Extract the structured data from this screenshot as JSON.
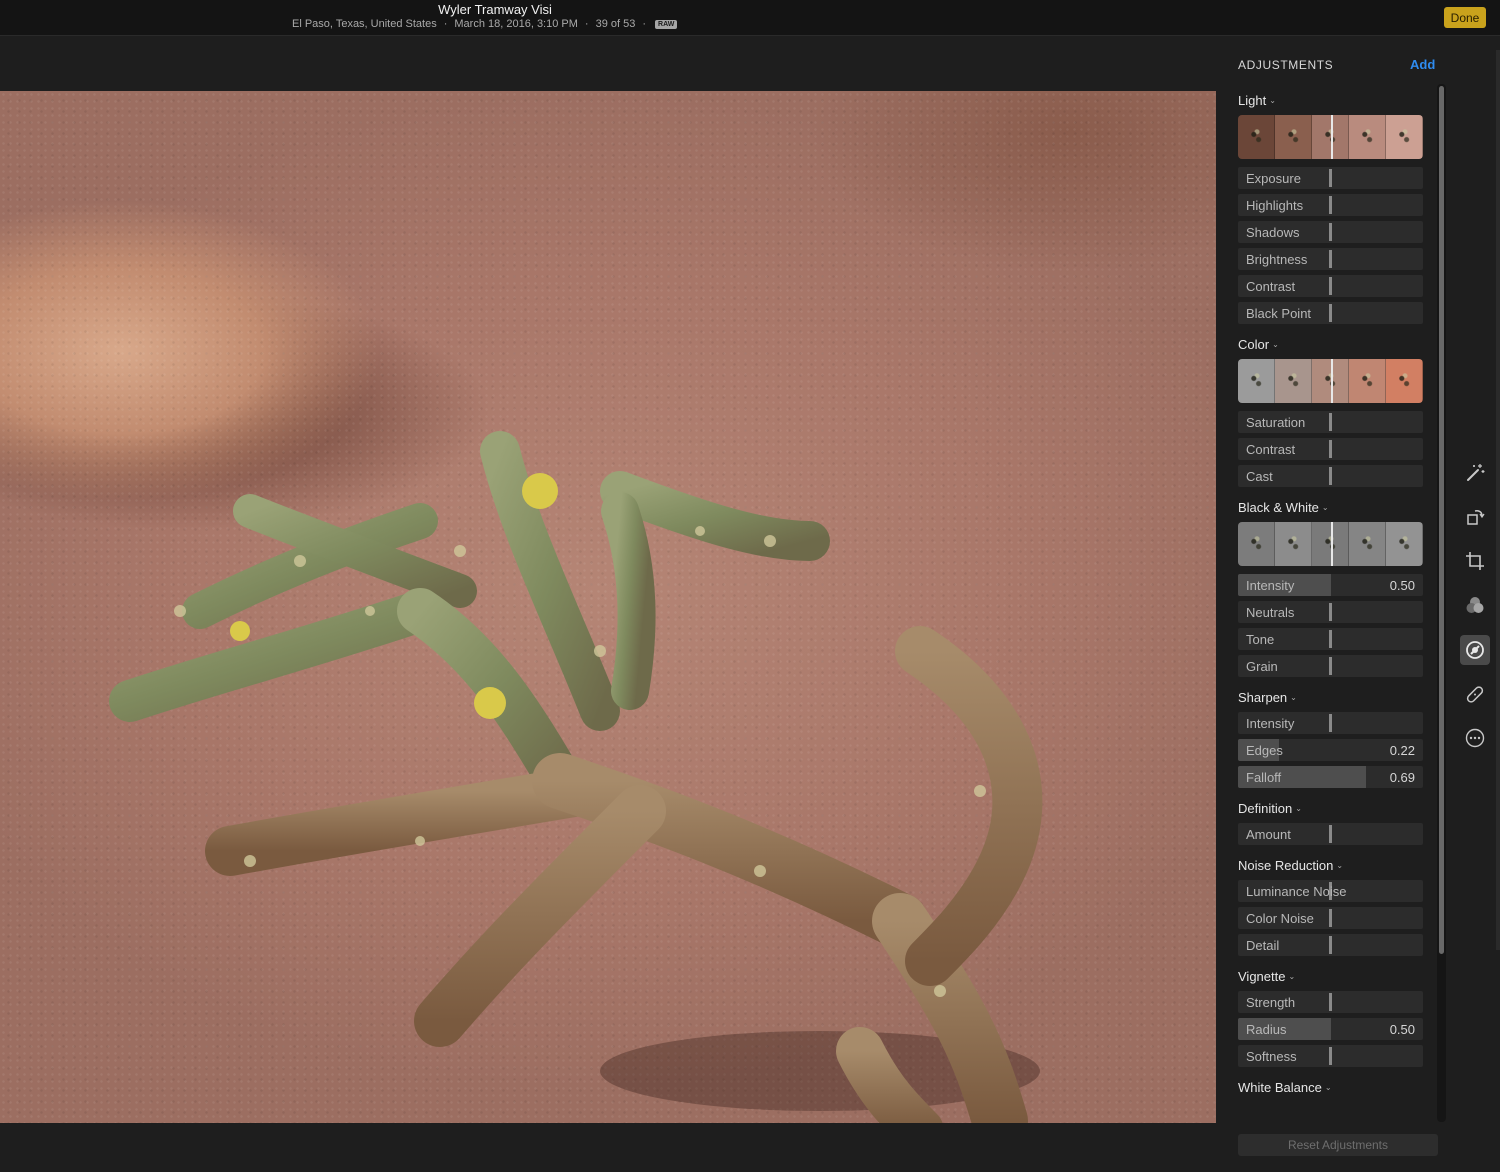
{
  "header": {
    "title": "Wyler Tramway Visi",
    "location": "El Paso, Texas, United States",
    "separator": "·",
    "datetime": "March 18, 2016, 3:10 PM",
    "counter": "39 of 53",
    "raw_badge": "RAW",
    "done_label": "Done"
  },
  "panel": {
    "heading": "ADJUSTMENTS",
    "add_label": "Add",
    "reset_label": "Reset Adjustments",
    "chevron": "⌄",
    "sections": [
      {
        "title": "Light",
        "thumbs": true,
        "thumb_colors": [
          "#6b4638",
          "#8a5f4e",
          "#a2776a",
          "#b98b7e",
          "#cca093"
        ],
        "sliders": [
          {
            "label": "Exposure",
            "value": "",
            "level": 0
          },
          {
            "label": "Highlights",
            "value": "",
            "level": 0
          },
          {
            "label": "Shadows",
            "value": "",
            "level": 0
          },
          {
            "label": "Brightness",
            "value": "",
            "level": 0
          },
          {
            "label": "Contrast",
            "value": "",
            "level": 0
          },
          {
            "label": "Black Point",
            "value": "",
            "level": 0
          }
        ]
      },
      {
        "title": "Color",
        "thumbs": true,
        "thumb_colors": [
          "#9b9b9b",
          "#a8958d",
          "#b08b7d",
          "#c08672",
          "#d27f63"
        ],
        "sliders": [
          {
            "label": "Saturation",
            "value": "",
            "level": 0
          },
          {
            "label": "Contrast",
            "value": "",
            "level": 0
          },
          {
            "label": "Cast",
            "value": "",
            "level": 0
          }
        ]
      },
      {
        "title": "Black & White",
        "thumbs": true,
        "thumb_colors": [
          "#7c7c7c",
          "#8c8c8c",
          "#7a7a7a",
          "#858585",
          "#939393"
        ],
        "sliders": [
          {
            "label": "Intensity",
            "value": "0.50",
            "level": 0.5
          },
          {
            "label": "Neutrals",
            "value": "",
            "level": 0
          },
          {
            "label": "Tone",
            "value": "",
            "level": 0
          },
          {
            "label": "Grain",
            "value": "",
            "level": 0
          }
        ]
      },
      {
        "title": "Sharpen",
        "thumbs": false,
        "sliders": [
          {
            "label": "Intensity",
            "value": "",
            "level": 0
          },
          {
            "label": "Edges",
            "value": "0.22",
            "level": 0.22
          },
          {
            "label": "Falloff",
            "value": "0.69",
            "level": 0.69
          }
        ]
      },
      {
        "title": "Definition",
        "thumbs": false,
        "sliders": [
          {
            "label": "Amount",
            "value": "",
            "level": 0
          }
        ]
      },
      {
        "title": "Noise Reduction",
        "thumbs": false,
        "sliders": [
          {
            "label": "Luminance Noise",
            "value": "",
            "level": 0
          },
          {
            "label": "Color Noise",
            "value": "",
            "level": 0
          },
          {
            "label": "Detail",
            "value": "",
            "level": 0
          }
        ]
      },
      {
        "title": "Vignette",
        "thumbs": false,
        "sliders": [
          {
            "label": "Strength",
            "value": "",
            "level": 0
          },
          {
            "label": "Radius",
            "value": "0.50",
            "level": 0.5
          },
          {
            "label": "Softness",
            "value": "",
            "level": 0
          }
        ]
      },
      {
        "title": "White Balance",
        "thumbs": false,
        "sliders": []
      }
    ]
  },
  "tools": [
    {
      "name": "magic-wand-icon",
      "active": false
    },
    {
      "name": "rotate-icon",
      "active": false
    },
    {
      "name": "crop-icon",
      "active": false
    },
    {
      "name": "filters-icon",
      "active": false
    },
    {
      "name": "adjust-icon",
      "active": true
    },
    {
      "name": "retouch-icon",
      "active": false
    },
    {
      "name": "more-icon",
      "active": false
    }
  ],
  "colors": {
    "accent": "#2f8cf0",
    "done": "#c9a21c"
  }
}
